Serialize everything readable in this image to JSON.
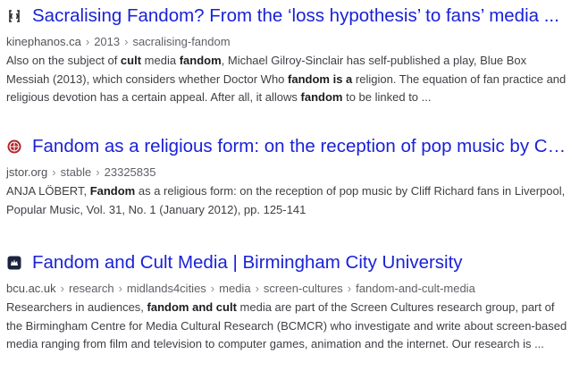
{
  "results": [
    {
      "icon": "kinephanos-icon",
      "title": "Sacralising Fandom? From the ‘loss hypothesis’ to fans’ media ...",
      "domain": "kinephanos.ca",
      "path": [
        "2013",
        "sacralising-fandom"
      ],
      "snippet": [
        {
          "t": "Also on the subject of ",
          "b": false
        },
        {
          "t": "cult",
          "b": true
        },
        {
          "t": " media ",
          "b": false
        },
        {
          "t": "fandom",
          "b": true
        },
        {
          "t": ", Michael Gilroy-Sinclair has self-published a play, Blue Box Messiah (2013), which considers whether Doctor Who ",
          "b": false
        },
        {
          "t": "fandom is a",
          "b": true
        },
        {
          "t": " religion. The equation of fan practice and religious devotion has a certain appeal. After all, it allows ",
          "b": false
        },
        {
          "t": "fandom",
          "b": true
        },
        {
          "t": " to be linked to ...",
          "b": false
        }
      ]
    },
    {
      "icon": "jstor-icon",
      "title": "Fandom as a religious form: on the reception of pop music by Cl...",
      "domain": "jstor.org",
      "path": [
        "stable",
        "23325835"
      ],
      "snippet": [
        {
          "t": "ANJA LÖBERT, ",
          "b": false
        },
        {
          "t": "Fandom",
          "b": true
        },
        {
          "t": " as a religious form: on the reception of pop music by Cliff Richard fans in Liverpool, Popular Music, Vol. 31, No. 1 (January 2012), pp. 125-141",
          "b": false
        }
      ]
    },
    {
      "icon": "bcu-icon",
      "title": "Fandom and Cult Media | Birmingham City University",
      "domain": "bcu.ac.uk",
      "path": [
        "research",
        "midlands4cities",
        "media",
        "screen-cultures",
        "fandom-and-cult-media"
      ],
      "snippet": [
        {
          "t": "Researchers in audiences, ",
          "b": false
        },
        {
          "t": "fandom and cult",
          "b": true
        },
        {
          "t": " media are part of the Screen Cultures research group, part of the Birmingham Centre for Media Cultural Research (BCMCR) who investigate and write about screen-based media ranging from film and television to computer games, animation and the internet. Our research is ...",
          "b": false
        }
      ]
    }
  ]
}
